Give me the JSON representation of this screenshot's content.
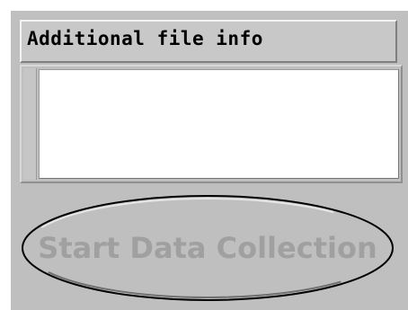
{
  "file_info": {
    "header_label": "Additional file info",
    "text_value": "",
    "placeholder": ""
  },
  "actions": {
    "start_label": "Start Data Collection",
    "start_enabled": false
  },
  "colors": {
    "panel": "#bfbfbf",
    "disabled_text": "#a0a0a0",
    "field_background": "#ffffff"
  }
}
